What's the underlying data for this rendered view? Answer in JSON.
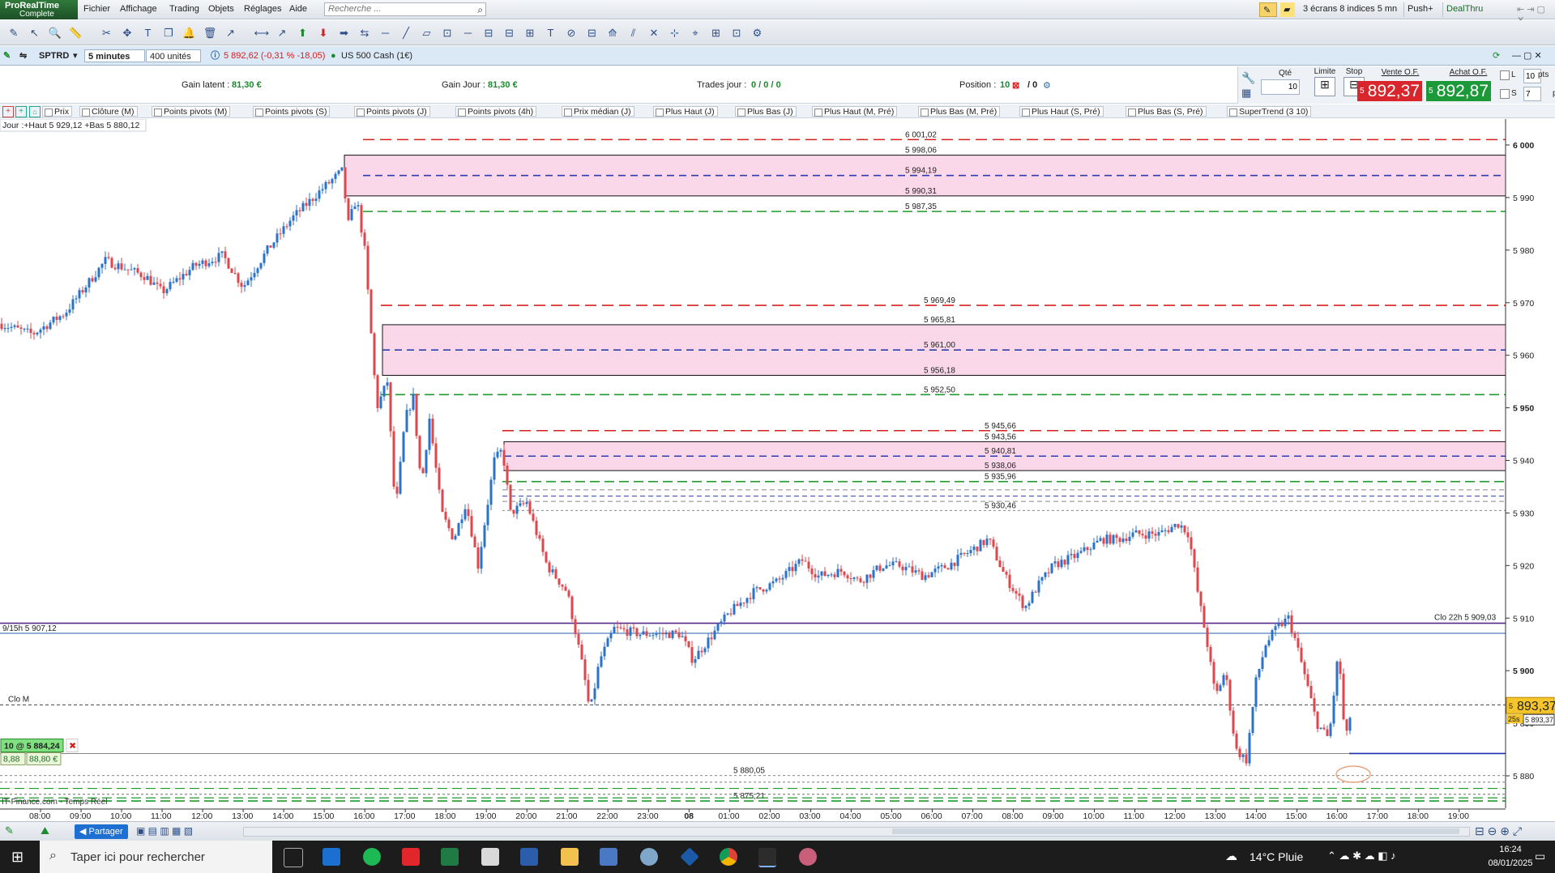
{
  "app": {
    "logo_line1": "ProRealTime",
    "logo_line2": "Complete",
    "menu": [
      "Fichier",
      "Affichage",
      "Trading",
      "Objets",
      "Réglages",
      "Aide"
    ],
    "search_placeholder": "Recherche ...",
    "right_buttons": {
      "layout": "3 écrans 8 indices 5 mn",
      "push": "Push+",
      "dealthru": "DealThru"
    }
  },
  "chart_header": {
    "ticker": "SPTRD",
    "timeframe": "5 minutes",
    "units": "400 unités",
    "last_price": "5 892,62 (-0,31 % -18,05)",
    "instrument": "US 500 Cash (1€)"
  },
  "trading": {
    "gain_latent_label": "Gain latent :",
    "gain_latent_value": "81,30 €",
    "gain_jour_label": "Gain Jour :",
    "gain_jour_value": "81,30 €",
    "trades_label": "Trades jour :",
    "trades_value": "0 / 0 / 0",
    "position_label": "Position :",
    "position_value": "10",
    "position_sep": "/ 0",
    "qty_label": "Qté",
    "qty_value": "10",
    "limit_label": "Limite",
    "stop_label": "Stop",
    "sell_label": "Vente O.F.",
    "buy_label": "Achat O.F.",
    "sell_prefix": "5",
    "sell_price": "892,37",
    "buy_prefix": "5",
    "buy_price": "892,87",
    "l_label": "L",
    "l_value": "10",
    "s_label": "S",
    "s_value": "7",
    "pts": "pts"
  },
  "indicators": [
    "Prix",
    "Clôture (M)",
    "Points pivots (M)",
    "Points pivots (S)",
    "Points pivots (J)",
    "Points pivots (4h)",
    "Prix médian (J)",
    "Plus Haut (J)",
    "Plus Bas (J)",
    "Plus Haut (M, Pré)",
    "Plus Bas (M, Pré)",
    "Plus Haut (S, Pré)",
    "Plus Bas (S, Pré)",
    "SuperTrend (3 10)"
  ],
  "chart_data": {
    "type": "candlestick",
    "info_label": "Jour :+Haut 5 929,12 +Bas 5 880,12",
    "y_ticks": [
      6000,
      5990,
      5980,
      5970,
      5960,
      5950,
      5940,
      5930,
      5920,
      5910,
      5900,
      5890,
      5880
    ],
    "y_tick_labels": [
      "6 000",
      "5 990",
      "5 980",
      "5 970",
      "5 960",
      "5 950",
      "5 940",
      "5 930",
      "5 920",
      "5 910",
      "5 900",
      "5 890",
      "5 880"
    ],
    "x_tick_labels": [
      "08:00",
      "09:00",
      "10:00",
      "11:00",
      "12:00",
      "13:00",
      "14:00",
      "15:00",
      "16:00",
      "17:00",
      "18:00",
      "19:00",
      "20:00",
      "21:00",
      "22:00",
      "23:00",
      "08",
      "01:00",
      "02:00",
      "03:00",
      "04:00",
      "05:00",
      "06:00",
      "07:00",
      "08:00",
      "09:00",
      "10:00",
      "11:00",
      "12:00",
      "13:00",
      "14:00",
      "15:00",
      "16:00",
      "17:00",
      "18:00",
      "19:00"
    ],
    "level_labels": [
      {
        "value": 6001.02,
        "label": "6 001,02",
        "color": "#d62020"
      },
      {
        "value": 5998.06,
        "label": "5 998,06",
        "color": "#222222"
      },
      {
        "value": 5994.19,
        "label": "5 994,19",
        "color": "#2b3fb0"
      },
      {
        "value": 5990.31,
        "label": "5 990,31",
        "color": "#222222"
      },
      {
        "value": 5987.35,
        "label": "5 987,35",
        "color": "#1f9a2b"
      },
      {
        "value": 5969.49,
        "label": "5 969,49",
        "color": "#d62020"
      },
      {
        "value": 5965.81,
        "label": "5 965,81",
        "color": "#222222"
      },
      {
        "value": 5961.0,
        "label": "5 961,00",
        "color": "#2b3fb0"
      },
      {
        "value": 5956.18,
        "label": "5 956,18",
        "color": "#222222"
      },
      {
        "value": 5952.5,
        "label": "5 952,50",
        "color": "#1f9a2b"
      },
      {
        "value": 5945.66,
        "label": "5 945,66",
        "color": "#d62020"
      },
      {
        "value": 5943.56,
        "label": "5 943,56",
        "color": "#222222"
      },
      {
        "value": 5940.81,
        "label": "5 940,81",
        "color": "#2b3fb0"
      },
      {
        "value": 5938.06,
        "label": "5 938,06",
        "color": "#222222"
      },
      {
        "value": 5935.96,
        "label": "5 935,96",
        "color": "#1f9a2b"
      },
      {
        "value": 5930.46,
        "label": "5 930,46",
        "color": "#888888"
      },
      {
        "value": 5880.05,
        "label": "5 880,05",
        "color": "#888888"
      },
      {
        "value": 5875.21,
        "label": "5 875,21",
        "color": "#1f9a2b"
      }
    ],
    "prev_close_label": "Clo 22h 5 909,03",
    "prev_close_value": 5909.03,
    "pivot_label": "9/15h 5 907,12",
    "pivot_value": 5907.12,
    "clo_m_label": "Clo M",
    "clo_m_value": 5893.5,
    "position_label": "10 @ 5 884,24",
    "position_value": 5884.24,
    "pnl_points": "8,88",
    "pnl_euros": "88,80 €",
    "price_tag_prefix": "5",
    "price_tag": "893,37",
    "price_tag_value": 5893.37,
    "price_tag_small": "25s",
    "price_tag_small2": "5 893,37",
    "source_label": "IT-Finance.com - Temps Réel",
    "colors": {
      "up": "#2a73c9",
      "down": "#e0474c",
      "zone": "#fbd7ea"
    }
  },
  "bottom": {
    "share": "Partager"
  },
  "taskbar": {
    "search_text": "Taper ici pour rechercher",
    "weather": "14°C Pluie",
    "time": "16:24",
    "date": "08/01/2025"
  }
}
